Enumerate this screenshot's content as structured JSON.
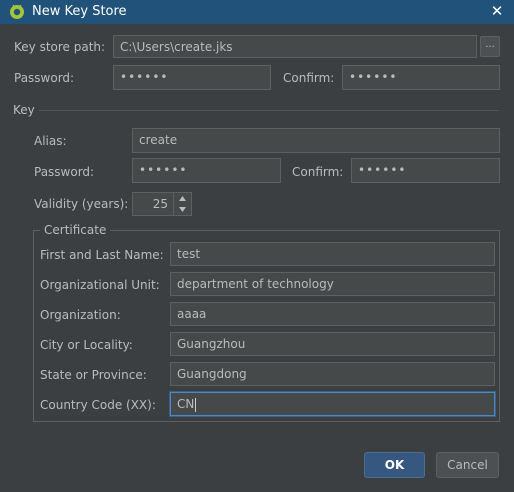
{
  "window": {
    "title": "New Key Store",
    "close_symbol": "✕"
  },
  "keystore": {
    "path_label": "Key store path:",
    "path_value": "C:\\Users\\create.jks",
    "browse_label": "...",
    "password_label": "Password:",
    "password_value": "••••••",
    "confirm_label": "Confirm:",
    "confirm_value": "••••••"
  },
  "key": {
    "section_label": "Key",
    "alias_label": "Alias:",
    "alias_value": "create",
    "password_label": "Password:",
    "password_value": "••••••",
    "confirm_label": "Confirm:",
    "confirm_value": "••••••",
    "validity_label": "Validity (years):",
    "validity_value": "25"
  },
  "certificate": {
    "section_label": "Certificate",
    "fields": [
      {
        "label": "First and Last Name:",
        "value": "test"
      },
      {
        "label": "Organizational Unit:",
        "value": "department of technology"
      },
      {
        "label": "Organization:",
        "value": "aaaa"
      },
      {
        "label": "City or Locality:",
        "value": "Guangzhou"
      },
      {
        "label": "State or Province:",
        "value": "Guangdong"
      },
      {
        "label": "Country Code (XX):",
        "value": "CN"
      }
    ]
  },
  "buttons": {
    "ok": "OK",
    "cancel": "Cancel"
  },
  "colors": {
    "titlebar": "#21527a",
    "dialog_bg": "#3c3f41",
    "field_bg": "#45494a",
    "ok_button": "#365880",
    "focus": "#4a88c7"
  }
}
